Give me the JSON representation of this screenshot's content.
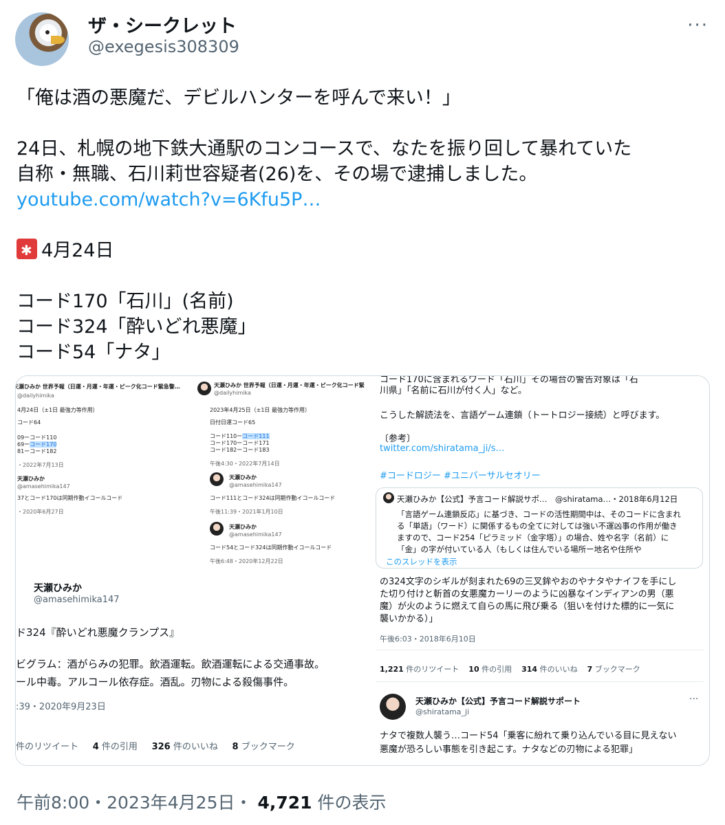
{
  "author": {
    "display_name": "ザ・シークレット",
    "handle": "@exegesis308309"
  },
  "tweet": {
    "line1": "「俺は酒の悪魔だ、デビルハンターを呼んで来い！」",
    "line2": "24日、札幌の地下鉄大通駅のコンコースで、なたを振り回して暴れていた",
    "line3": "自称・無職、石川莉世容疑者(26)を、その場で逮捕しました。",
    "link": "youtube.com/watch?v=6Kfu5P…",
    "date_line": "4月24日",
    "code1": "コード170「石川」(名前)",
    "code2": "コード324「酔いどれ悪魔」",
    "code3": "コード54「ナタ」"
  },
  "media": {
    "panel_a": {
      "title": "天瀬ひみか 世界予報（日運・月運・年運・ピーク化コード緊急警…",
      "handle": "@dailyhimika",
      "l1": "4月24日（±1日 最強力等作用）",
      "l2": "コード64",
      "l3": "09ーコード110",
      "l4a": "69ー",
      "l4b": "コード170",
      "l5": "81ーコード182",
      "time": "・2022年7月13日",
      "reply_name": "天瀬ひみか",
      "reply_handle": "@amasehimika147",
      "reply_text": "37とコード170は同期作動イコールコード",
      "reply_time": "・2020年6月27日"
    },
    "panel_b": {
      "title": "天瀬ひみか 世界予報（日運・月運・年運・ピーク化コード緊急警…",
      "handle": "@dailyhimika",
      "l1": "2023年4月25日（±1日 最強力等作用）",
      "l2": "日付日運コード65",
      "l3a": "コード110ー",
      "l3b": "コード111",
      "l4": "コード170ーコード171",
      "l5": "コード182ーコード183",
      "time": "午後4:30・2022年7月14日",
      "r1_name": "天瀬ひみか",
      "r1_handle": "@amasehimika147",
      "r1_text": "コード111とコード324は同期作動イコールコード",
      "r1_time": "午後11:39・2021年1月10日",
      "r2_name": "天瀬ひみか",
      "r2_handle": "@amasehimika147",
      "r2_text": "コード54とコード324は同期作動イコールコード",
      "r2_time": "午後6:48・2020年12月22日"
    },
    "panel_c": {
      "name": "天瀬ひみか",
      "handle": "@amasehimika147",
      "t1": "ド324『酔いどれ悪魔クランプス』",
      "t2": "ビグラム：酒がらみの犯罪。飲酒運転。飲酒運転による交通事故。",
      "t3": "ール中毒。アルコール依存症。酒乱。刃物による殺傷事件。",
      "time": ":39・2020年9月23日",
      "rt_label": "件のリツイート",
      "quotes_num": "4",
      "quotes_label": "件の引用",
      "likes_num": "326",
      "likes_label": "件のいいね",
      "bm_num": "8",
      "bm_label": "ブックマーク"
    },
    "panel_d": {
      "top1": "コード170に含まれるワード「石川」その場合の警告対象は「石",
      "top2": "川県」「名前に石川が付く人」など。",
      "p1": "こうした解読法を、言語ゲーム連鎖（トートロジー接続）と呼びます。",
      "ref": "〔参考〕",
      "ref_link": "twitter.com/shiratama_ji/s…",
      "hashtags": "#コードロジー #ユニバーサルセオリー",
      "q_head": "天瀬ひみか【公式】予言コード解説サポ…　@shiratama…・2018年6月12日",
      "q1": "「言語ゲーム連鎖反応」に基づき、コードの活性期間中は、そのコードに含まれ",
      "q2": "る「単語」（ワード）に関係するもの全てに対しては強い不運凶事の作用が働き",
      "q3": "ますので、コード254「ピラミッド（金字塔）」の場合、姓や名字（名前）に",
      "q4": "「金」の字が付いている人（もしくは住んでいる場所ー地名や住所や",
      "q_link": "このスレッドを表示",
      "b1": "の324文字のシギルが刻まれた69の三叉鉾やおのやナタやナイフを手にし",
      "b2": "た切り付けと斬首の女悪魔カーリーのように凶暴なインディアンの男（悪",
      "b3": "魔）が火のように燃えて自らの馬に飛び乗る（狙いを付けた標的に一気に",
      "b4": "襲いかかる）」",
      "time": "午後6:03・2018年6月10日",
      "s1n": "1,221",
      "s1l": "件のリツイート",
      "s2n": "10",
      "s2l": "件の引用",
      "s3n": "314",
      "s3l": "件のいいね",
      "s4n": "7",
      "s4l": "ブックマーク",
      "r_name": "天瀬ひみか【公式】予言コード解説サポート",
      "r_handle": "@shiratama_ji",
      "r1": "ナタで複数人襲う…コード54「乗客に紛れて乗り込んでいる目に見えない",
      "r2": "悪魔が恐ろしい事態を引き起こす。ナタなどの刃物による犯罪」"
    }
  },
  "footer": {
    "time": "午前8:00・2023年4月25日・",
    "views_num": "4,721",
    "views_label": "件の表示"
  },
  "colors": {
    "link": "#1d9bf0",
    "muted": "#536471",
    "text": "#0f1419"
  },
  "icons": [
    "eagle-avatar",
    "more-icon",
    "siren-icon"
  ]
}
